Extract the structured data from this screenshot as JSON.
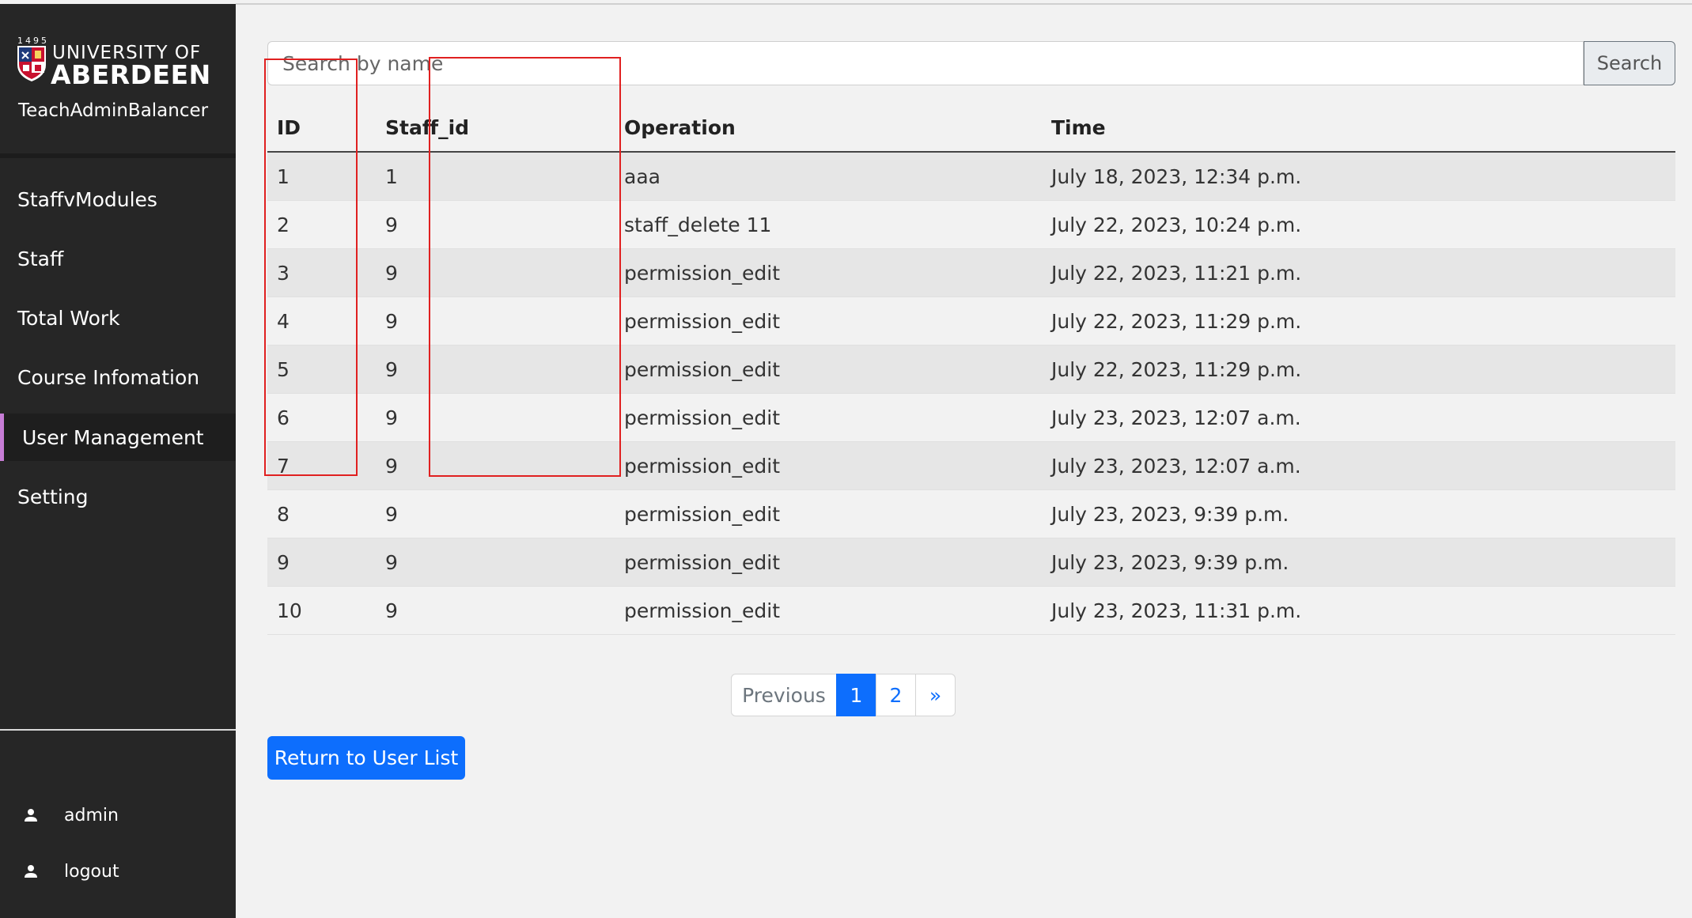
{
  "brand": {
    "year": "1495",
    "university_line1": "UNIVERSITY OF",
    "university_line2": "ABERDEEN",
    "app_name": "TeachAdminBalancer"
  },
  "sidebar": {
    "items": [
      {
        "label": "StaffvModules",
        "active": false
      },
      {
        "label": "Staff",
        "active": false
      },
      {
        "label": "Total Work",
        "active": false
      },
      {
        "label": "Course Infomation",
        "active": false
      },
      {
        "label": "User Management",
        "active": true
      },
      {
        "label": "Setting",
        "active": false
      }
    ],
    "user_items": [
      {
        "label": "admin",
        "icon": "person-icon"
      },
      {
        "label": "logout",
        "icon": "person-icon"
      }
    ],
    "active_accent": "#c77dd6"
  },
  "search": {
    "placeholder": "Search by name",
    "value": "",
    "button_label": "Search"
  },
  "table": {
    "columns": [
      "ID",
      "Staff_id",
      "Operation",
      "Time"
    ],
    "rows": [
      [
        "1",
        "1",
        "aaa",
        "July 18, 2023, 12:34 p.m."
      ],
      [
        "2",
        "9",
        "staff_delete 11",
        "July 22, 2023, 10:24 p.m."
      ],
      [
        "3",
        "9",
        "permission_edit",
        "July 22, 2023, 11:21 p.m."
      ],
      [
        "4",
        "9",
        "permission_edit",
        "July 22, 2023, 11:29 p.m."
      ],
      [
        "5",
        "9",
        "permission_edit",
        "July 22, 2023, 11:29 p.m."
      ],
      [
        "6",
        "9",
        "permission_edit",
        "July 23, 2023, 12:07 a.m."
      ],
      [
        "7",
        "9",
        "permission_edit",
        "July 23, 2023, 12:07 a.m."
      ],
      [
        "8",
        "9",
        "permission_edit",
        "July 23, 2023, 9:39 p.m."
      ],
      [
        "9",
        "9",
        "permission_edit",
        "July 23, 2023, 9:39 p.m."
      ],
      [
        "10",
        "9",
        "permission_edit",
        "July 23, 2023, 11:31 p.m."
      ]
    ]
  },
  "pagination": {
    "previous_label": "Previous",
    "pages": [
      "1",
      "2"
    ],
    "current_page": "1",
    "next_label": "»"
  },
  "return_button_label": "Return to User List",
  "colors": {
    "sidebar_bg": "#262626",
    "primary": "#0d6efd",
    "annotation_red": "#e02020"
  }
}
